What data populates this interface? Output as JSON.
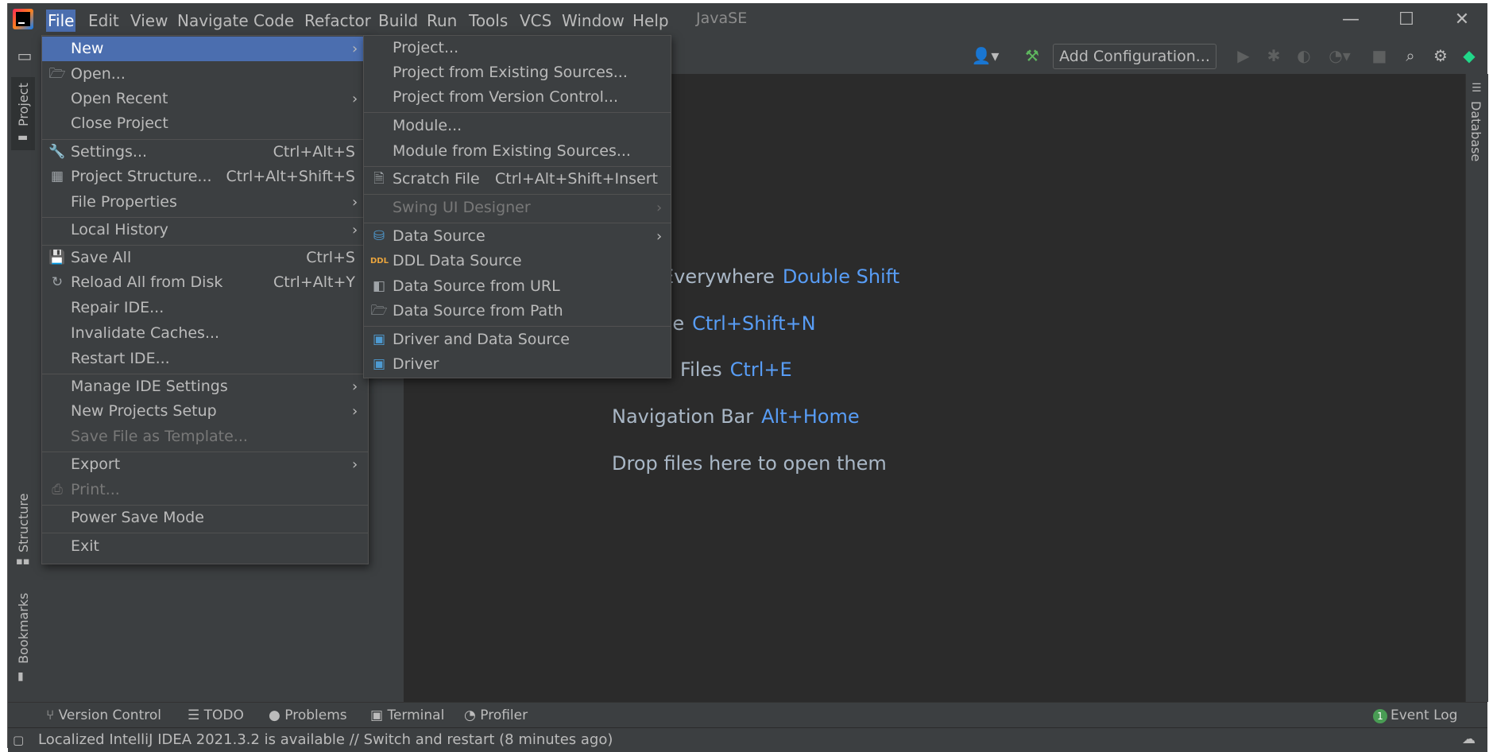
{
  "window": {
    "title": "JavaSE"
  },
  "menubar": {
    "items": [
      "File",
      "Edit",
      "View",
      "Navigate",
      "Code",
      "Refactor",
      "Build",
      "Run",
      "Tools",
      "VCS",
      "Window",
      "Help"
    ]
  },
  "window_controls": {
    "minimize": "—",
    "maximize": "☐",
    "close": "✕"
  },
  "toolbar": {
    "add_configuration": "Add Configuration..."
  },
  "side_tools": {
    "project": "Project",
    "structure": "Structure",
    "bookmarks": "Bookmarks",
    "database": "Database"
  },
  "file_menu": {
    "items": [
      {
        "label": "New",
        "submenu": true,
        "selected": true
      },
      {
        "label": "Open...",
        "icon": "folder-icon"
      },
      {
        "label": "Open Recent",
        "submenu": true
      },
      {
        "label": "Close Project"
      },
      {
        "label": "Settings...",
        "shortcut": "Ctrl+Alt+S",
        "icon": "wrench-icon"
      },
      {
        "label": "Project Structure...",
        "shortcut": "Ctrl+Alt+Shift+S",
        "icon": "project-structure-icon"
      },
      {
        "label": "File Properties",
        "submenu": true
      },
      {
        "label": "Local History",
        "submenu": true
      },
      {
        "label": "Save All",
        "shortcut": "Ctrl+S",
        "icon": "save-icon"
      },
      {
        "label": "Reload All from Disk",
        "shortcut": "Ctrl+Alt+Y",
        "icon": "reload-icon"
      },
      {
        "label": "Repair IDE..."
      },
      {
        "label": "Invalidate Caches..."
      },
      {
        "label": "Restart IDE..."
      },
      {
        "label": "Manage IDE Settings",
        "submenu": true
      },
      {
        "label": "New Projects Setup",
        "submenu": true
      },
      {
        "label": "Save File as Template...",
        "disabled": true
      },
      {
        "label": "Export",
        "submenu": true
      },
      {
        "label": "Print...",
        "disabled": true,
        "icon": "print-icon"
      },
      {
        "label": "Power Save Mode"
      },
      {
        "label": "Exit"
      }
    ]
  },
  "new_submenu": {
    "items": [
      {
        "label": "Project..."
      },
      {
        "label": "Project from Existing Sources..."
      },
      {
        "label": "Project from Version Control..."
      },
      {
        "label": "Module..."
      },
      {
        "label": "Module from Existing Sources..."
      },
      {
        "label": "Scratch File",
        "shortcut": "Ctrl+Alt+Shift+Insert",
        "icon": "scratch-file-icon"
      },
      {
        "label": "Swing UI Designer",
        "submenu": true,
        "disabled": true
      },
      {
        "label": "Data Source",
        "submenu": true,
        "icon": "database-icon"
      },
      {
        "label": "DDL Data Source",
        "icon": "ddl-icon"
      },
      {
        "label": "Data Source from URL",
        "icon": "url-datasource-icon"
      },
      {
        "label": "Data Source from Path",
        "icon": "folder-icon"
      },
      {
        "label": "Driver and Data Source",
        "icon": "driver-icon"
      },
      {
        "label": "Driver",
        "icon": "driver-icon"
      }
    ]
  },
  "editor_hints": [
    {
      "text": "Everywhere",
      "key": "Double Shift"
    },
    {
      "text": "ile",
      "key": "Ctrl+Shift+N"
    },
    {
      "text": "Files",
      "key": "Ctrl+E"
    },
    {
      "text": "Navigation Bar",
      "key": "Alt+Home"
    },
    {
      "text": "Drop files here to open them",
      "key": ""
    }
  ],
  "bottom_tools": {
    "version_control": "Version Control",
    "todo": "TODO",
    "problems": "Problems",
    "terminal": "Terminal",
    "profiler": "Profiler",
    "event_log": "Event Log",
    "event_log_count": "1"
  },
  "status": {
    "message": "Localized IntelliJ IDEA 2021.3.2 is available // Switch and restart (8 minutes ago)"
  },
  "colors": {
    "accent": "#4b6eaf",
    "key_hint": "#589df6",
    "background": "#2b2b2b",
    "panel": "#3c3f41"
  }
}
